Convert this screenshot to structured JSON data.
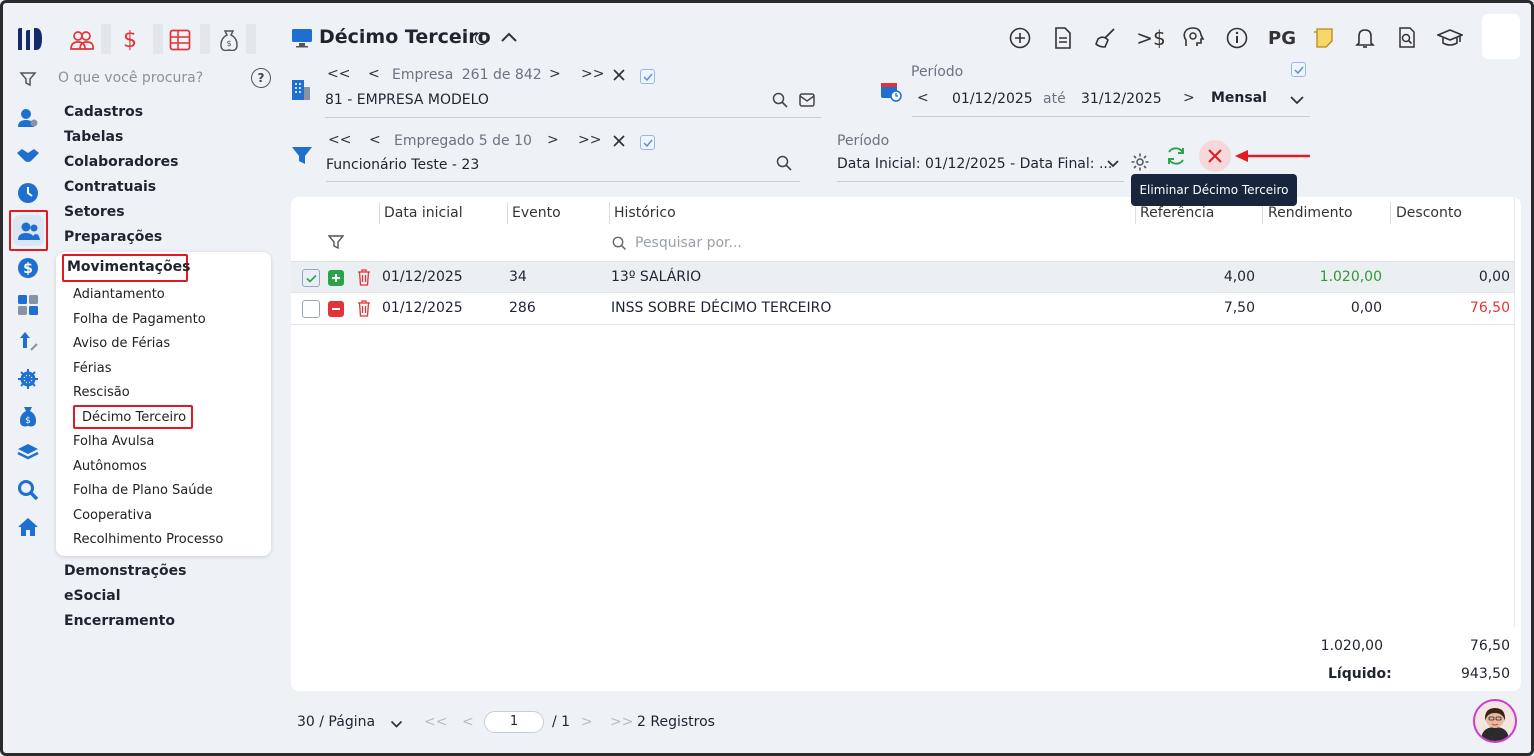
{
  "header": {
    "title": "Décimo Terceiro",
    "pg_label": "PG"
  },
  "search": {
    "placeholder": "O que você procura?"
  },
  "sidebar": {
    "sections": [
      "Cadastros",
      "Tabelas",
      "Colaboradores",
      "Contratuais",
      "Setores",
      "Preparações",
      "Movimentações",
      "Demonstrações",
      "eSocial",
      "Encerramento"
    ],
    "sub_items": [
      "Adiantamento",
      "Folha de Pagamento",
      "Aviso de Férias",
      "Férias",
      "Rescisão",
      "Décimo Terceiro",
      "Folha Avulsa",
      "Autônomos",
      "Folha de Plano Saúde",
      "Cooperativa",
      "Recolhimento Processo"
    ]
  },
  "company": {
    "label": "Empresa",
    "index": "261",
    "of": "de",
    "total": "842",
    "name": "81 - EMPRESA MODELO"
  },
  "employee": {
    "label": "Empregado 5 de 10",
    "name": "Funcionário Teste - 23"
  },
  "period_top": {
    "label": "Período",
    "start": "01/12/2025",
    "until": "até",
    "end": "31/12/2025",
    "mode": "Mensal"
  },
  "period_bottom": {
    "label": "Período",
    "value": "Data Inicial: 01/12/2025 - Data Final: ..."
  },
  "tooltip": "Eliminar Décimo Terceiro",
  "table": {
    "headers": [
      "Data inicial",
      "Evento",
      "Histórico",
      "Referência",
      "Rendimento",
      "Desconto"
    ],
    "search_placeholder": "Pesquisar por...",
    "rows": [
      {
        "date": "01/12/2025",
        "event": "34",
        "history": "13º SALÁRIO",
        "ref": "4,00",
        "income": "1.020,00",
        "discount": "0,00"
      },
      {
        "date": "01/12/2025",
        "event": "286",
        "history": "INSS SOBRE DÉCIMO TERCEIRO",
        "ref": "7,50",
        "income": "0,00",
        "discount": "76,50"
      }
    ],
    "total_income": "1.020,00",
    "total_discount": "76,50",
    "net_label": "Líquido:",
    "net_value": "943,50"
  },
  "pagination": {
    "per_page": "30 / Página",
    "page": "1",
    "of_pages": "/ 1",
    "records": "2 Registros"
  },
  "colors": {
    "accent": "#1f6fd1",
    "red": "#e01a22",
    "green": "#2aa34a",
    "income_green": "#2d9a35",
    "discount_red": "#e03535"
  }
}
